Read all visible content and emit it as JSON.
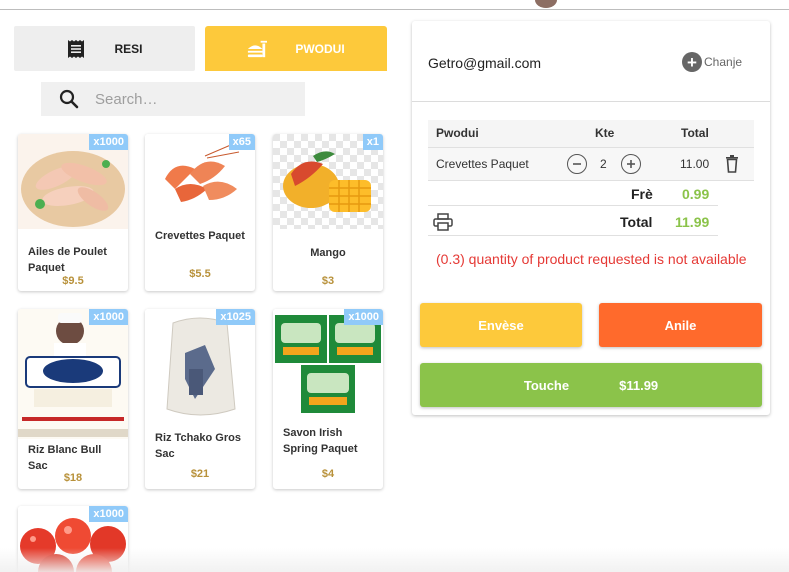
{
  "tabs": {
    "receipt_label": "RESI",
    "products_label": "PWODUI"
  },
  "search": {
    "placeholder": "Search…",
    "value": ""
  },
  "products": [
    {
      "name": "Ailes de Poulet Paquet",
      "price": "$9.5",
      "stock": "x1000",
      "image": "chicken-wings"
    },
    {
      "name": "Crevettes Paquet",
      "price": "$5.5",
      "stock": "x65",
      "image": "shrimp"
    },
    {
      "name": "Mango",
      "price": "$3",
      "stock": "x1",
      "image": "mango"
    },
    {
      "name": "Riz Blanc Bull Sac",
      "price": "$18",
      "stock": "x1000",
      "image": "rice-bull-bag"
    },
    {
      "name": "Riz Tchako Gros Sac",
      "price": "$21",
      "stock": "x1025",
      "image": "rice-sack"
    },
    {
      "name": "Savon Irish Spring Paquet",
      "price": "$4",
      "stock": "x1000",
      "image": "irish-spring-soap"
    },
    {
      "name": "",
      "price": "",
      "stock": "x1000",
      "image": "tomatoes"
    }
  ],
  "cart": {
    "customer_email": "Getro@gmail.com",
    "change_label": "Chanje",
    "columns": {
      "product": "Pwodui",
      "qty": "Kte",
      "total": "Total"
    },
    "items": [
      {
        "product": "Crevettes Paquet",
        "qty": "2",
        "total": "11.00"
      }
    ],
    "fee_label": "Frè",
    "fee_value": "0.99",
    "total_label": "Total",
    "total_value": "11.99",
    "error_message": "(0.3) quantity of product requested is not available"
  },
  "actions": {
    "send_label": "Envèse",
    "cancel_label": "Anile",
    "pay_label": "Touche",
    "pay_amount": "$11.99"
  },
  "colors": {
    "accent_yellow": "#fdc93b",
    "cancel_orange": "#ff6a2c",
    "pay_green": "#8bc34a",
    "badge_blue": "#90caf9",
    "price_gold": "#b8913a",
    "error_red": "#e53935"
  }
}
